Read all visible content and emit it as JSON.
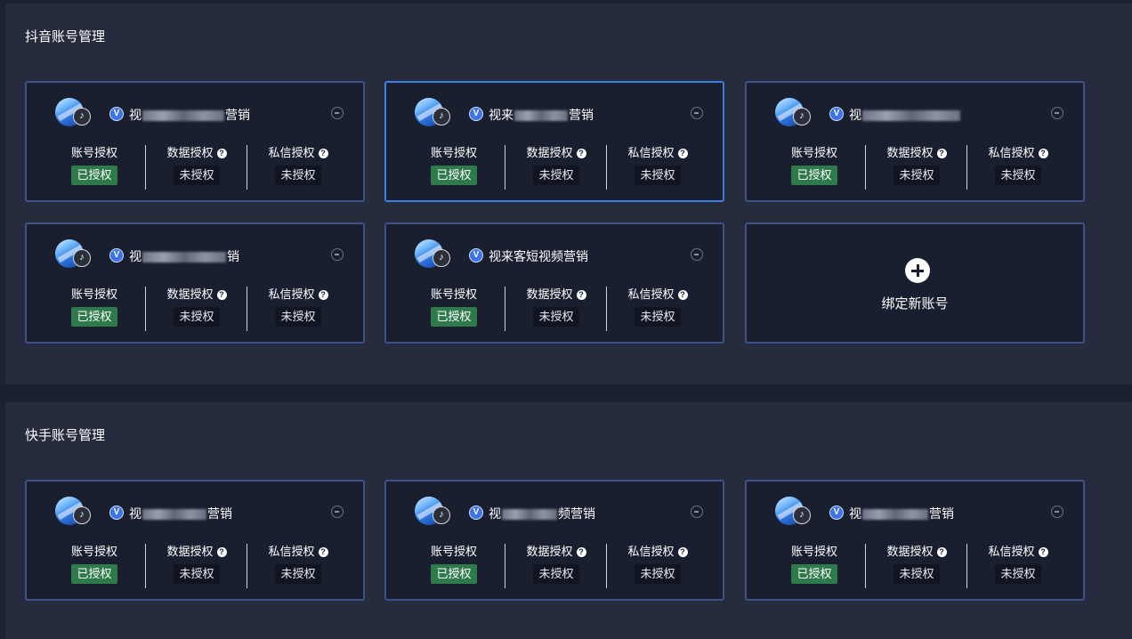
{
  "sections": {
    "douyin": {
      "title": "抖音账号管理",
      "accounts": [
        {
          "name_prefix": "视",
          "name_suffix": "营销",
          "col0_label": "账号授权",
          "col0_status": "已授权",
          "col1_label": "数据授权",
          "col1_status": "未授权",
          "col2_label": "私信授权",
          "col2_status": "未授权"
        },
        {
          "name_prefix": "视来",
          "name_suffix": "营销",
          "col0_label": "账号授权",
          "col0_status": "已授权",
          "col1_label": "数据授权",
          "col1_status": "未授权",
          "col2_label": "私信授权",
          "col2_status": "未授权"
        },
        {
          "name_prefix": "视",
          "name_suffix": "",
          "col0_label": "账号授权",
          "col0_status": "已授权",
          "col1_label": "数据授权",
          "col1_status": "未授权",
          "col2_label": "私信授权",
          "col2_status": "未授权"
        },
        {
          "name_prefix": "视",
          "name_suffix": "销",
          "col0_label": "账号授权",
          "col0_status": "已授权",
          "col1_label": "数据授权",
          "col1_status": "未授权",
          "col2_label": "私信授权",
          "col2_status": "未授权"
        },
        {
          "name_prefix": "视来客短视频营销",
          "name_suffix": "",
          "col0_label": "账号授权",
          "col0_status": "已授权",
          "col1_label": "数据授权",
          "col1_status": "未授权",
          "col2_label": "私信授权",
          "col2_status": "未授权"
        }
      ],
      "add_label": "绑定新账号"
    },
    "kuaishou": {
      "title": "快手账号管理",
      "accounts": [
        {
          "name_prefix": "视",
          "name_suffix": "营销",
          "col0_label": "账号授权",
          "col0_status": "已授权",
          "col1_label": "数据授权",
          "col1_status": "未授权",
          "col2_label": "私信授权",
          "col2_status": "未授权"
        },
        {
          "name_prefix": "视",
          "name_suffix": "频营销",
          "col0_label": "账号授权",
          "col0_status": "已授权",
          "col1_label": "数据授权",
          "col1_status": "未授权",
          "col2_label": "私信授权",
          "col2_status": "未授权"
        },
        {
          "name_prefix": "视",
          "name_suffix": "营销",
          "col0_label": "账号授权",
          "col0_status": "已授权",
          "col1_label": "数据授权",
          "col1_status": "未授权",
          "col2_label": "私信授权",
          "col2_status": "未授权"
        }
      ]
    }
  },
  "icons": {
    "verified": "V",
    "help": "?",
    "tiktok": "♪"
  },
  "colors": {
    "authorized_bg": "#2f7a4b",
    "selected_border": "#3f7de0",
    "card_border": "#3d5387"
  }
}
